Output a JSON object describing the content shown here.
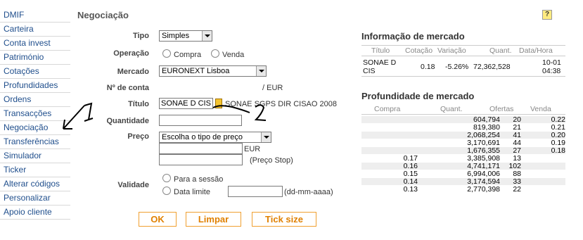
{
  "sidebar": {
    "items": [
      "DMIF",
      "Carteira",
      "Conta invest",
      "Património",
      "Cotações",
      "Profundidades",
      "Ordens",
      "Transacções",
      "Negociação",
      "Transferências",
      "Simulador",
      "Ticker",
      "Alterar códigos",
      "Personalizar",
      "Apoio cliente"
    ]
  },
  "page": {
    "title": "Negociação",
    "help": "?"
  },
  "form": {
    "tipo": {
      "label": "Tipo",
      "value": "Simples"
    },
    "operacao": {
      "label": "Operação",
      "option1": "Compra",
      "option2": "Venda"
    },
    "mercado": {
      "label": "Mercado",
      "value": "EURONEXT Lisboa"
    },
    "conta": {
      "label": "Nº de conta",
      "suffix": "/ EUR"
    },
    "titulo": {
      "label": "Título",
      "value": "SONAE D CIS",
      "description": "SONAE SGPS DIR CISAO 2008"
    },
    "quantidade": {
      "label": "Quantidade",
      "value": ""
    },
    "preco": {
      "label": "Preço",
      "select": "Escolha o tipo de preço",
      "currency": "EUR",
      "stop_label": "(Preço Stop)"
    },
    "validade": {
      "label": "Validade",
      "option1": "Para a sessão",
      "option2": "Data limite",
      "date_format": "(dd-mm-aaaa)"
    }
  },
  "buttons": {
    "ok": "OK",
    "limpar": "Limpar",
    "tick": "Tick size"
  },
  "market_info": {
    "title": "Informação de mercado",
    "headers": [
      "Título",
      "Cotação",
      "Variação",
      "Quant.",
      "Data/Hora"
    ],
    "row": {
      "titulo_l1": "SONAE D",
      "titulo_l2": "CIS",
      "cotacao": "0.18",
      "variacao": "-5.26%",
      "quant": "72,362,528",
      "data": "10-01",
      "hora": "04:38"
    }
  },
  "depth": {
    "title": "Profundidade de mercado",
    "headers": [
      "Compra",
      "Quant.",
      "Ofertas",
      "Venda"
    ],
    "rows": [
      [
        "",
        "604,794",
        "20",
        "0.22"
      ],
      [
        "",
        "819,380",
        "21",
        "0.21"
      ],
      [
        "",
        "2,068,254",
        "41",
        "0.20"
      ],
      [
        "",
        "3,170,691",
        "44",
        "0.19"
      ],
      [
        "",
        "1,676,355",
        "27",
        "0.18"
      ],
      [
        "0.17",
        "3,385,908",
        "13",
        ""
      ],
      [
        "0.16",
        "4,741,171",
        "102",
        ""
      ],
      [
        "0.15",
        "6,994,006",
        "88",
        ""
      ],
      [
        "0.14",
        "3,174,594",
        "33",
        ""
      ],
      [
        "0.13",
        "2,770,398",
        "22",
        ""
      ]
    ]
  },
  "annotations": {
    "label1": "1",
    "label2": "2"
  }
}
